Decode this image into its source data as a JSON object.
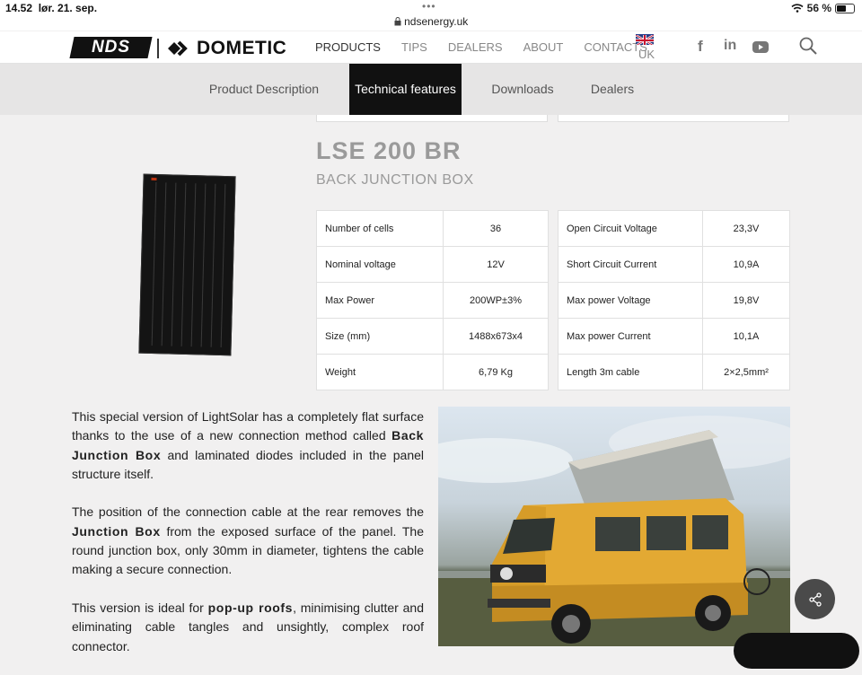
{
  "statusbar": {
    "time": "14.52",
    "date": "lør. 21. sep.",
    "dots": "•••",
    "url": "ndsenergy.uk",
    "battery": "56 %",
    "battery_level": 0.56
  },
  "brand": {
    "nds": "NDS",
    "dometic": "DOMETIC"
  },
  "nav": {
    "items": [
      "PRODUCTS",
      "TIPS",
      "DEALERS",
      "ABOUT",
      "CONTACTS"
    ],
    "country": "UK"
  },
  "subnav": {
    "tabs": [
      "Product Description",
      "Technical features",
      "Downloads",
      "Dealers"
    ],
    "active": "Technical features"
  },
  "product": {
    "title": "LSE 200 BR",
    "subtitle": "BACK JUNCTION BOX"
  },
  "specs_left": [
    {
      "label": "Number of cells",
      "value": "36"
    },
    {
      "label": "Nominal voltage",
      "value": "12V"
    },
    {
      "label": "Max Power",
      "value": "200WP±3%"
    },
    {
      "label": "Size (mm)",
      "value": "1488x673x4"
    },
    {
      "label": "Weight",
      "value": "6,79 Kg"
    }
  ],
  "specs_right": [
    {
      "label": "Open Circuit Voltage",
      "value": "23,3V"
    },
    {
      "label": "Short Circuit Current",
      "value": "10,9A"
    },
    {
      "label": "Max power Voltage",
      "value": "19,8V"
    },
    {
      "label": "Max power Current",
      "value": "10,1A"
    },
    {
      "label": "Length 3m cable",
      "value": "2×2,5mm²"
    }
  ],
  "description": {
    "p1_a": "This special version of LightSolar has a completely flat surface thanks to the use of a new connection method called ",
    "p1_b": "Back Junction Box",
    "p1_c": " and laminated diodes included in the panel structure itself.",
    "p2_a": "The position of the connection cable at the rear removes the ",
    "p2_b": "Junction Box",
    "p2_c": " from the exposed surface of the panel. The round junction box, only 30mm in diameter, tightens the cable making a secure connection.",
    "p3_a": "This version is ideal for ",
    "p3_b": "pop-up roofs",
    "p3_c": ", minimising clutter and eliminating cable tangles and unsightly, complex roof connector."
  },
  "icons": {
    "wifi": "wifi-icon",
    "lock": "lock-icon",
    "facebook": "facebook-icon",
    "linkedin": "linkedin-icon",
    "youtube": "youtube-icon",
    "search": "search-icon",
    "share": "share-icon",
    "flag": "uk-flag-icon"
  },
  "colors": {
    "active_tab": "#111111",
    "van": "#e0a82e",
    "page_bg": "#f1f0f0"
  }
}
